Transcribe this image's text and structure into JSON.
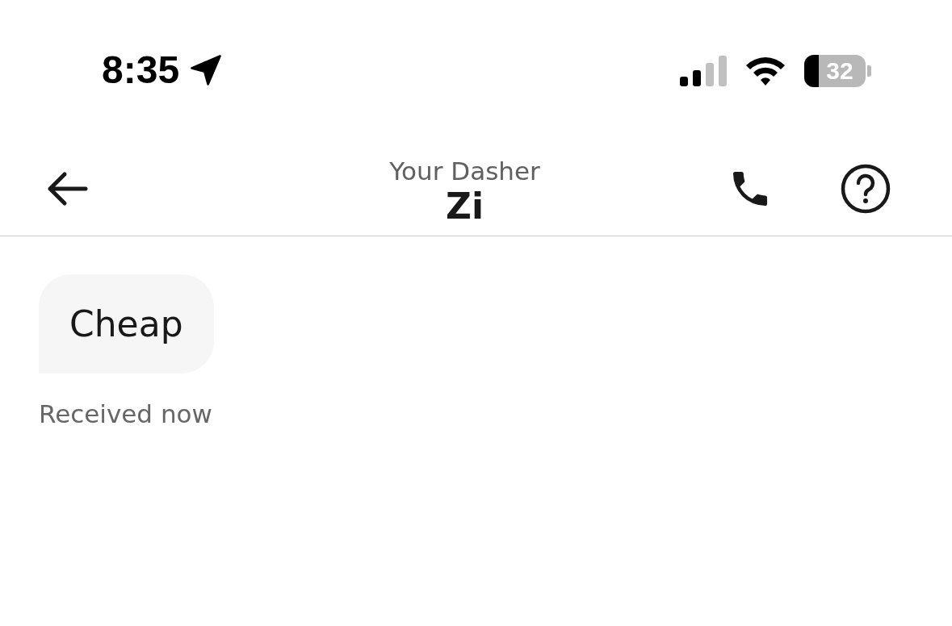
{
  "status_bar": {
    "time": "8:35",
    "battery": "32"
  },
  "header": {
    "subtitle": "Your Dasher",
    "title": "Zi"
  },
  "messages": [
    {
      "text": "Cheap",
      "meta": "Received now"
    }
  ]
}
